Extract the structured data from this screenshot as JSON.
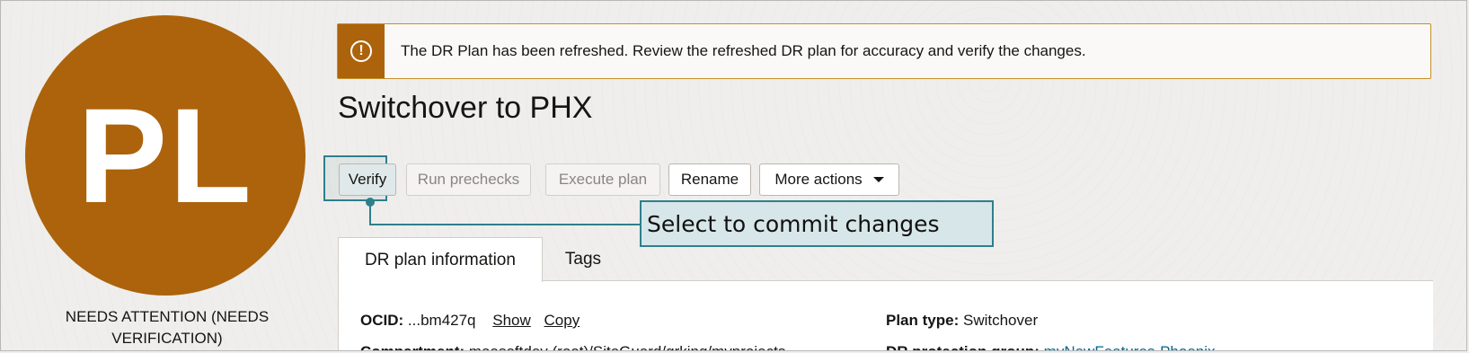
{
  "avatar": {
    "initials": "PL",
    "color": "#ac630c"
  },
  "status": {
    "text": "NEEDS ATTENTION (NEEDS VERIFICATION)"
  },
  "alert": {
    "icon": "exclamation-circle-icon",
    "message": "The DR Plan has been refreshed. Review the refreshed DR plan for accuracy and verify the changes."
  },
  "page": {
    "title": "Switchover to PHX"
  },
  "toolbar": {
    "verify_label": "Verify",
    "run_prechecks_label": "Run prechecks",
    "execute_plan_label": "Execute plan",
    "rename_label": "Rename",
    "more_actions_label": "More actions"
  },
  "callout": {
    "text": "Select to commit changes",
    "color": "#2e7f8c"
  },
  "tabs": [
    {
      "label": "DR plan information",
      "active": true
    },
    {
      "label": "Tags",
      "active": false
    }
  ],
  "info": {
    "ocid_label": "OCID:",
    "ocid_value": "...bm427q",
    "show_label": "Show",
    "copy_label": "Copy",
    "plan_type_label": "Plan type:",
    "plan_type_value": "Switchover",
    "compartment_label": "Compartment:",
    "compartment_value": "maasoftdev (root)/SiteGuard/grking/myprojects",
    "protection_group_label": "DR protection group:",
    "protection_group_value": "myNewFeatures-Phoenix"
  }
}
